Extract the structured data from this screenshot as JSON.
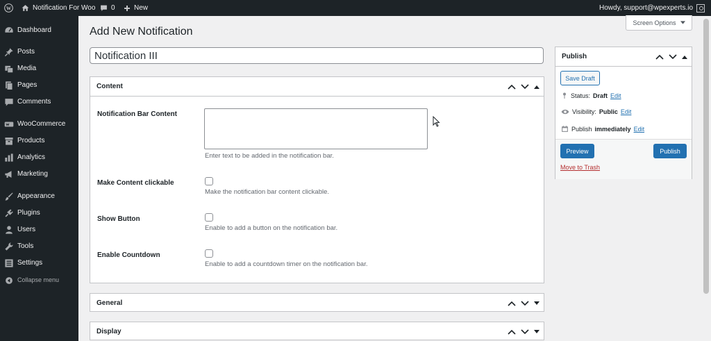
{
  "admin_bar": {
    "site_name": "Notification For Woo",
    "comments_count": "0",
    "new_label": "New",
    "howdy": "Howdy, support@wpexperts.io"
  },
  "sidebar": {
    "items": [
      {
        "label": "Dashboard",
        "icon": "dashboard-icon"
      },
      {
        "label": "Posts",
        "icon": "pin-icon"
      },
      {
        "label": "Media",
        "icon": "media-icon"
      },
      {
        "label": "Pages",
        "icon": "pages-icon"
      },
      {
        "label": "Comments",
        "icon": "comment-icon"
      },
      {
        "label": "WooCommerce",
        "icon": "woocommerce-icon"
      },
      {
        "label": "Products",
        "icon": "archive-icon"
      },
      {
        "label": "Analytics",
        "icon": "chart-icon"
      },
      {
        "label": "Marketing",
        "icon": "megaphone-icon"
      },
      {
        "label": "Appearance",
        "icon": "paintbrush-icon"
      },
      {
        "label": "Plugins",
        "icon": "plugin-icon"
      },
      {
        "label": "Users",
        "icon": "users-icon"
      },
      {
        "label": "Tools",
        "icon": "wrench-icon"
      },
      {
        "label": "Settings",
        "icon": "settings-icon"
      }
    ],
    "collapse_label": "Collapse menu"
  },
  "main": {
    "page_title": "Add New Notification",
    "screen_options": "Screen Options",
    "post_title": "Notification III"
  },
  "content_box": {
    "title": "Content",
    "fields": [
      {
        "label": "Notification Bar Content",
        "description": "Enter text to be added in the notification bar.",
        "value": ""
      },
      {
        "label": "Make Content clickable",
        "description": "Make the notification bar content clickable.",
        "checked": false
      },
      {
        "label": "Show Button",
        "description": "Enable to add a button on the notification bar.",
        "checked": false
      },
      {
        "label": "Enable Countdown",
        "description": "Enable to add a countdown timer on the notification bar.",
        "checked": false
      }
    ]
  },
  "general_box": {
    "title": "General"
  },
  "display_box": {
    "title": "Display"
  },
  "publish": {
    "title": "Publish",
    "save_draft": "Save Draft",
    "status_label": "Status:",
    "status_value": "Draft",
    "visibility_label": "Visibility:",
    "visibility_value": "Public",
    "publish_label": "Publish",
    "publish_value": "immediately",
    "edit_label": "Edit",
    "preview": "Preview",
    "publish_button": "Publish",
    "trash": "Move to Trash"
  },
  "colors": {
    "admin_bar": "#1d2327",
    "primary": "#2271b1",
    "trash": "#b32d2e",
    "background": "#f0f0f1"
  }
}
